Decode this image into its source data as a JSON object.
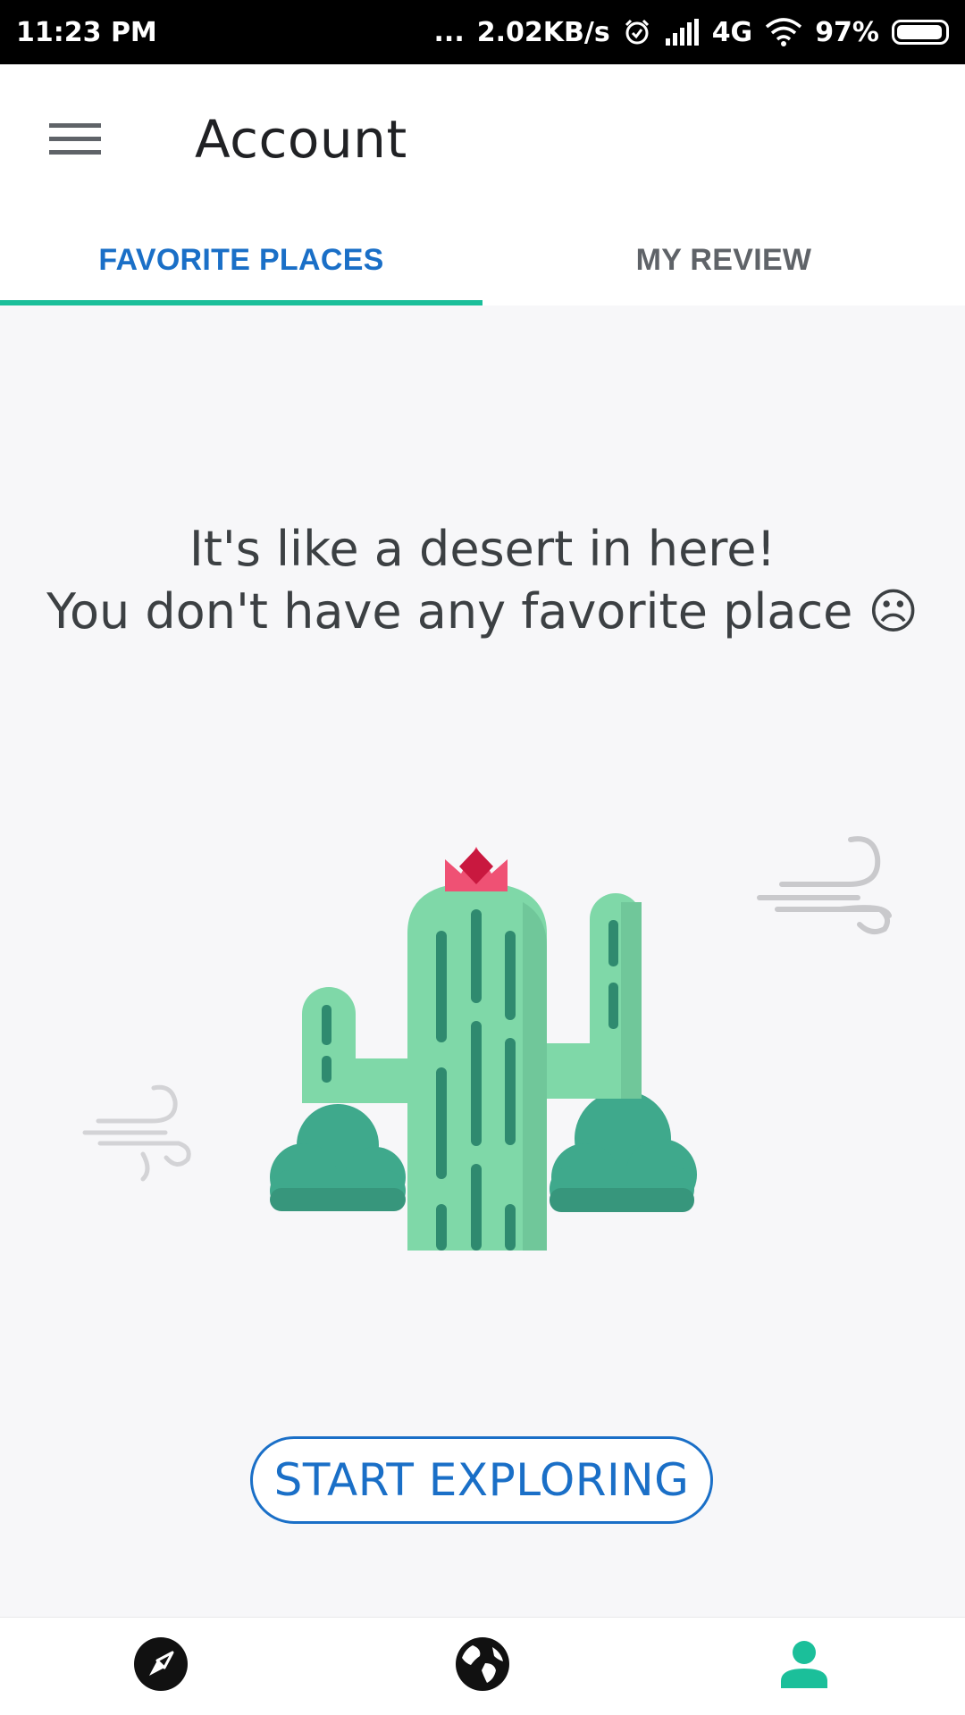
{
  "status_bar": {
    "time": "11:23 PM",
    "dots": "...",
    "network_speed": "2.02KB/s",
    "network_type": "4G",
    "battery": "97%",
    "battery_level": 0.97,
    "icons": [
      "alarm-icon",
      "signal-icon",
      "wifi-icon",
      "battery-icon"
    ]
  },
  "app_bar": {
    "menu_icon": "hamburger-menu-icon",
    "title": "Account"
  },
  "tabs": [
    {
      "label": "FAVORITE PLACES",
      "active": true
    },
    {
      "label": "MY REVIEW",
      "active": false
    }
  ],
  "empty_state": {
    "line1": "It's like a desert in here!",
    "line2": "You don't have any favorite place ☹",
    "illustration": "cactus-illustration"
  },
  "cta": {
    "label": "START EXPLORING"
  },
  "bottom_nav": [
    {
      "icon": "compass-icon",
      "active": false
    },
    {
      "icon": "globe-icon",
      "active": false
    },
    {
      "icon": "person-icon",
      "active": true
    }
  ],
  "colors": {
    "accent_blue": "#1a6fc7",
    "tab_indicator": "#1bbf9a",
    "nav_active": "#1bbf9a",
    "cactus_light": "#7fd8a8",
    "cactus_dark": "#2f8a6f",
    "flower": "#e8305a"
  }
}
